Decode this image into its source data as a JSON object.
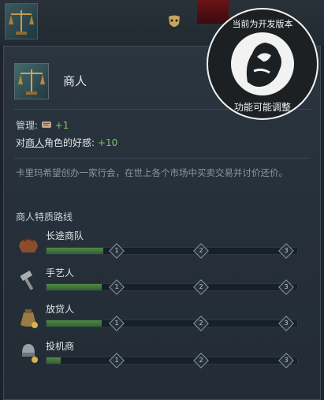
{
  "title": "商人",
  "stats": {
    "management_label": "管理:",
    "management_value": "+1",
    "opinion_prefix": "对",
    "opinion_link": "商人",
    "opinion_suffix": "角色的好感:",
    "opinion_value": "+10"
  },
  "description": "卡里玛希望创办一家行会，在世上各个市场中买卖交易并讨价还价。",
  "section_title": "商人特质路线",
  "milestones": [
    "1",
    "2",
    "3"
  ],
  "tracks": [
    {
      "label": "长途商队",
      "icon": "saddle-icon",
      "progress": 0.25
    },
    {
      "label": "手艺人",
      "icon": "hammer-icon",
      "progress": 0.25
    },
    {
      "label": "放贷人",
      "icon": "coin-bag-icon",
      "progress": 0.25
    },
    {
      "label": "投机商",
      "icon": "helmet-coins-icon",
      "progress": 0.06
    }
  ],
  "seal_text": "当前为开发版本 功能可能调整",
  "colors": {
    "accent_green": "#7fc26a",
    "track_fill": "#4e8a44",
    "panel_bg": "#27313b"
  }
}
